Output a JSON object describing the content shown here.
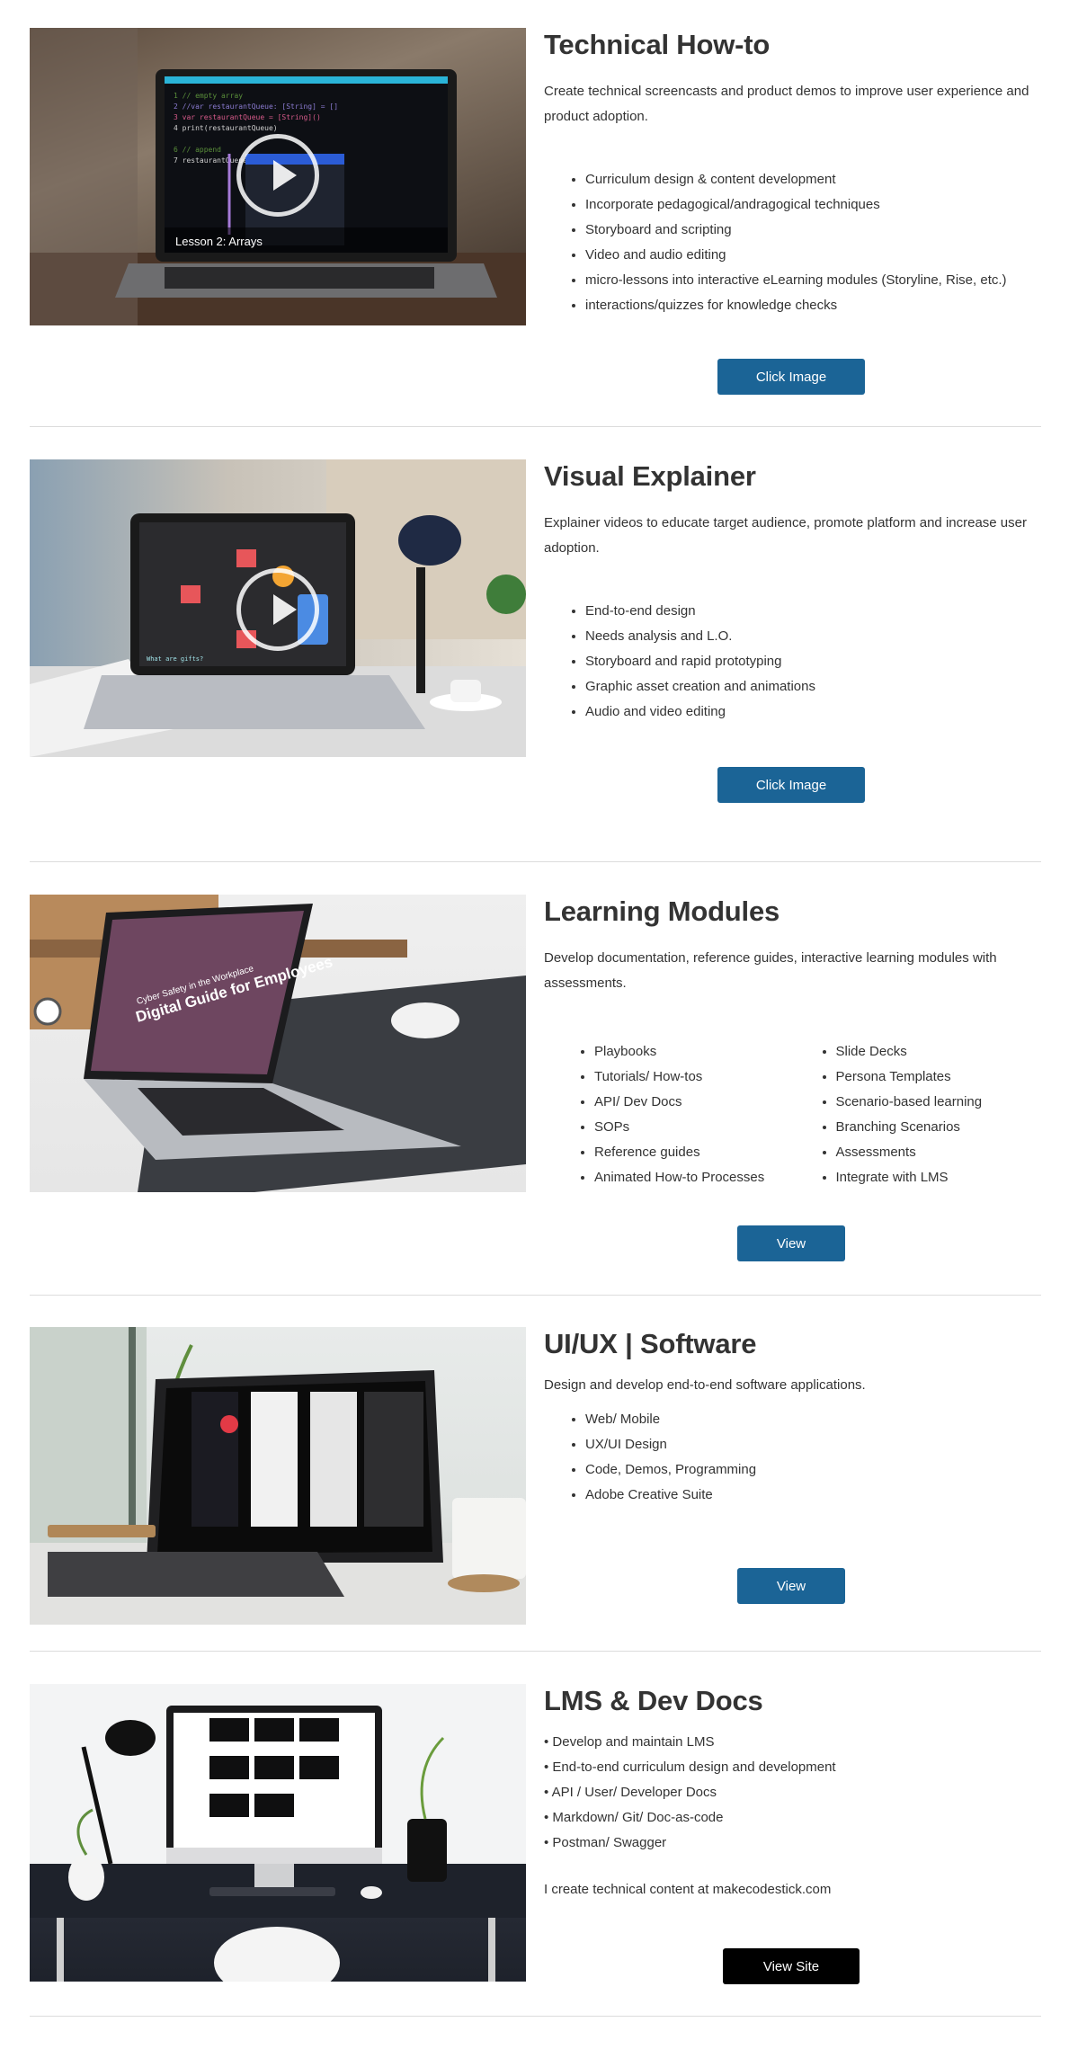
{
  "sections": [
    {
      "title": "Technical How-to",
      "description": "Create technical screencasts and product demos to improve user experience and product adoption.",
      "bullets": [
        "Curriculum design & content development",
        "Incorporate pedagogical/andragogical techniques",
        "Storyboard and scripting",
        "Video and audio editing",
        "micro-lessons into interactive eLearning modules  (Storyline, Rise, etc.)",
        "interactions/quizzes for knowledge checks"
      ],
      "button_label": "Click Image",
      "image_caption": "Lesson 2: Arrays",
      "image_icon": "laptop-code-video-thumbnail"
    },
    {
      "title": "Visual Explainer",
      "description": "Explainer videos to educate target audience, promote platform and increase user adoption.",
      "bullets": [
        "End-to-end design",
        "Needs analysis and L.O.",
        "Storyboard and rapid prototyping",
        "Graphic asset creation and animations",
        "Audio and video editing"
      ],
      "button_label": "Click Image",
      "image_caption": "What are gifts?",
      "image_icon": "laptop-explainer-video-thumbnail"
    },
    {
      "title": "Learning Modules",
      "description": "Develop documentation, reference guides, interactive learning modules with assessments.",
      "bullets_left": [
        "Playbooks",
        "Tutorials/ How-tos",
        "API/ Dev Docs",
        "SOPs",
        "Reference guides",
        "Animated How-to Processes"
      ],
      "bullets_right": [
        "Slide Decks",
        "Persona Templates",
        "Scenario-based learning",
        "Branching Scenarios",
        "Assessments",
        "Integrate with LMS"
      ],
      "button_label": "View",
      "image_caption": "Digital Guide for Employees",
      "image_subcaption": "Cyber Safety in the Workplace",
      "image_icon": "laptop-guide-thumbnail"
    },
    {
      "title": "UI/UX | Software",
      "description": "Design and develop end-to-end software applications.",
      "bullets": [
        "Web/ Mobile",
        "UX/UI Design",
        "Code, Demos, Programming",
        "Adobe Creative Suite"
      ],
      "button_label": "View",
      "image_icon": "tablet-app-screens-thumbnail"
    },
    {
      "title": "LMS & Dev Docs",
      "lines": [
        "• Develop and maintain LMS",
        "• End-to-end curriculum design and development",
        "• API / User/ Developer Docs",
        "• Markdown/ Git/ Doc-as-code",
        "• Postman/ Swagger"
      ],
      "footer_text": "I create technical content at makecodestick.com",
      "button_label": "View Site",
      "image_icon": "desktop-monitor-thumbnail"
    }
  ],
  "colors": {
    "button_blue": "#1b6496",
    "button_black": "#000000",
    "divider": "#dcdcdc",
    "text": "#333333"
  }
}
